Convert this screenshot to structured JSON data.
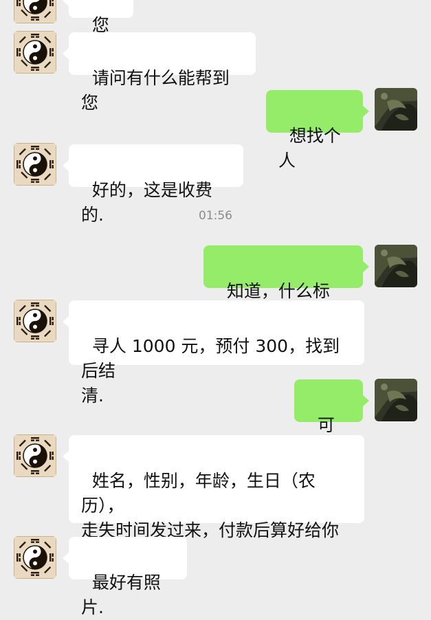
{
  "colors": {
    "background": "#ededed",
    "incoming_bubble": "#ffffff",
    "outgoing_bubble": "#95ec69",
    "timestamp_text": "#8a8a8a"
  },
  "avatars": {
    "contact": "yin-yang-bagua-icon",
    "user": "dark-green-photo-avatar"
  },
  "messages": [
    {
      "from": "contact",
      "text": "您好。"
    },
    {
      "from": "contact",
      "text": "请问有什么能帮到您"
    },
    {
      "from": "user",
      "text": "想找个人"
    },
    {
      "from": "contact",
      "text": "好的，这是收费的."
    },
    {
      "from": "user",
      "text": "知道，什么标准?"
    },
    {
      "from": "contact",
      "text": "寻人 1000 元，预付 300，找到后结\n清."
    },
    {
      "from": "user",
      "text": "可以。"
    },
    {
      "from": "contact",
      "text": "姓名，性别，年龄，生日（农历），\n走失时间发过来，付款后算好给你\n发结果."
    },
    {
      "from": "contact",
      "text": "最好有照片."
    }
  ],
  "timestamp": "01:56"
}
